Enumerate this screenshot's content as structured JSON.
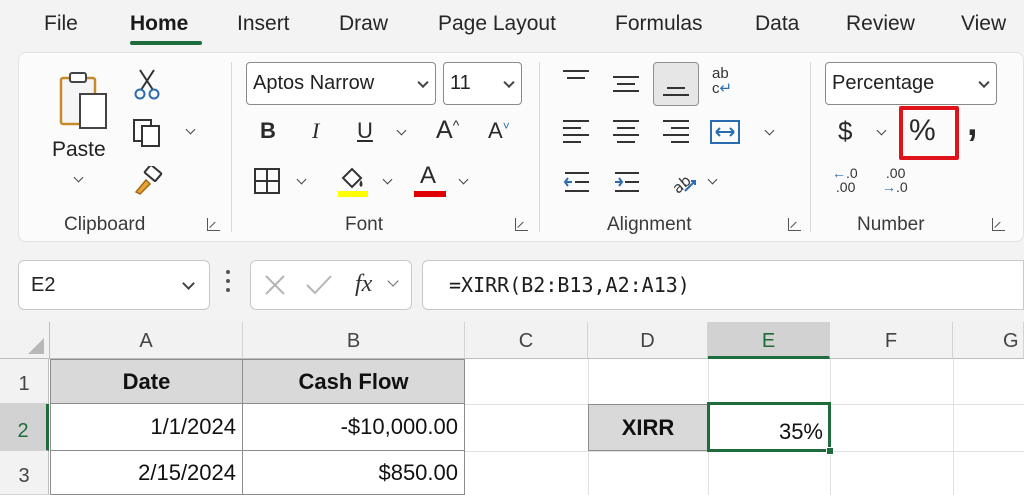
{
  "menu": {
    "tabs": [
      "File",
      "Home",
      "Insert",
      "Draw",
      "Page Layout",
      "Formulas",
      "Data",
      "Review",
      "View"
    ],
    "active": "Home"
  },
  "ribbon": {
    "clipboard": {
      "paste_label": "Paste",
      "group_label": "Clipboard"
    },
    "font": {
      "font_name": "Aptos Narrow",
      "font_size": "11",
      "group_label": "Font",
      "highlight_color": "#ffff00",
      "font_color": "#e00000"
    },
    "alignment": {
      "group_label": "Alignment"
    },
    "number": {
      "format": "Percentage",
      "currency": "$",
      "percent": "%",
      "comma": ",",
      "group_label": "Number",
      "highlight_color": "#e0131b"
    }
  },
  "formula_bar": {
    "name_box": "E2",
    "fx": "fx",
    "formula": "=XIRR(B2:B13,A2:A13)"
  },
  "grid": {
    "columns": [
      "A",
      "B",
      "C",
      "D",
      "E",
      "F",
      "G"
    ],
    "selected_column": "E",
    "rows": [
      "1",
      "2",
      "3"
    ],
    "selected_row": "2",
    "cells": {
      "A1": "Date",
      "B1": "Cash Flow",
      "A2": "1/1/2024",
      "B2": "-$10,000.00",
      "A3": "2/15/2024",
      "B3": "$850.00",
      "D2": "XIRR",
      "E2": "35%"
    },
    "accent": "#1e6b3c"
  }
}
